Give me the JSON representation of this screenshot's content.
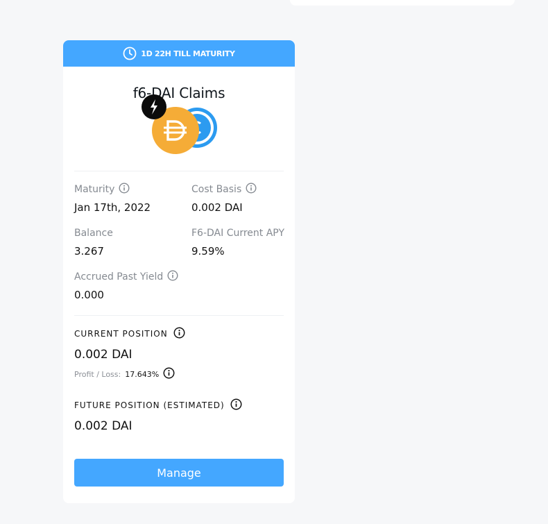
{
  "header": {
    "maturity_countdown": "1D 22H TILL MATURITY"
  },
  "card": {
    "title": "f6-DAI Claims",
    "maturity": {
      "label": "Maturity",
      "value": "Jan 17th, 2022"
    },
    "cost_basis": {
      "label": "Cost Basis",
      "value": "0.002 DAI"
    },
    "balance": {
      "label": "Balance",
      "value": "3.267"
    },
    "apy": {
      "label": "F6-DAI Current APY",
      "value": "9.59%"
    },
    "accrued": {
      "label": "Accrued Past Yield",
      "value": "0.000"
    },
    "current_position": {
      "label": "CURRENT POSITION",
      "value": "0.002 DAI",
      "pl_label": "Profit / Loss:",
      "pl_value": "17.643%"
    },
    "future_position": {
      "label": "FUTURE POSITION (ESTIMATED)",
      "value": "0.002 DAI"
    },
    "manage_label": "Manage"
  },
  "icons": [
    "clock-icon",
    "bolt-icon",
    "dai-token-icon",
    "protocol-token-icon",
    "info-icon"
  ],
  "colors": {
    "accent": "#44a7ff",
    "dai": "#f5ac37",
    "protocol": "#2c9bf0"
  }
}
